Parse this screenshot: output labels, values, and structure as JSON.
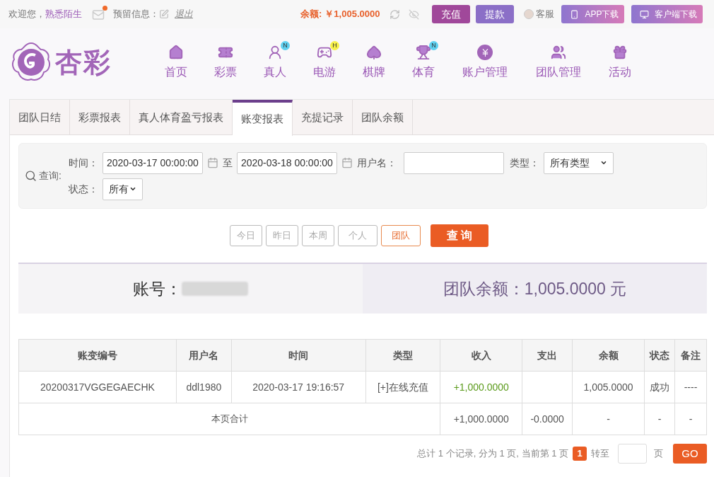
{
  "top_bar": {
    "welcome": "欢迎您，",
    "username": "熟悉陌生",
    "mail_unread": true,
    "reserved_info": "预留信息：",
    "logout": "退出",
    "balance_label": "余额:",
    "balance": "￥1,005.0000",
    "buttons": [
      {
        "label": "充值",
        "kind": "deposit"
      },
      {
        "label": "提款",
        "kind": "withdraw"
      }
    ],
    "service": "客服",
    "downloads": [
      {
        "label": "APP下载",
        "kind": "phone"
      },
      {
        "label": "客户端下载",
        "kind": "desktop"
      }
    ]
  },
  "logo": "杏彩",
  "nav": [
    {
      "label": "首页",
      "kind": "home"
    },
    {
      "label": "彩票",
      "kind": "ticket"
    },
    {
      "label": "真人",
      "kind": "person",
      "badge": "N"
    },
    {
      "label": "电游",
      "kind": "game",
      "badge": "H"
    },
    {
      "label": "棋牌",
      "kind": "cards"
    },
    {
      "label": "体育",
      "kind": "trophy",
      "badge": "N"
    },
    {
      "label": "账户管理",
      "kind": "yen"
    },
    {
      "label": "团队管理",
      "kind": "team"
    },
    {
      "label": "活动",
      "kind": "gift"
    }
  ],
  "tabs": [
    {
      "label": "团队日结",
      "selected": false
    },
    {
      "label": "彩票报表",
      "selected": false
    },
    {
      "label": "真人体育盈亏报表",
      "selected": false
    },
    {
      "label": "账变报表",
      "selected": true
    },
    {
      "label": "充提记录",
      "selected": false
    },
    {
      "label": "团队余额",
      "selected": false
    }
  ],
  "query": {
    "label": "查询:",
    "time_label": "时间：",
    "start": "2020-03-17 00:00:00",
    "to": "至",
    "end": "2020-03-18 00:00:00",
    "username_label": "用户名：",
    "type_label": "类型：",
    "type": "所有类型",
    "status_label": "状态：",
    "status": "所有"
  },
  "quick_filters": [
    {
      "label": "今日",
      "selected": false
    },
    {
      "label": "昨日",
      "selected": false
    },
    {
      "label": "本周",
      "selected": false
    },
    {
      "label": "个人",
      "selected": false
    },
    {
      "label": "团队",
      "selected": true
    }
  ],
  "search_button": "查 询",
  "summary": {
    "account_label": "账号：",
    "team_balance": "团队余额：1,005.0000 元"
  },
  "table": {
    "columns": [
      "账变编号",
      "用户名",
      "时间",
      "类型",
      "收入",
      "支出",
      "余额",
      "状态",
      "备注"
    ],
    "rows": [
      [
        "20200317VGGEGAECHK",
        "ddl1980",
        "2020-03-17 19:16:57",
        "[+]在线充值",
        "+1,000.0000",
        "",
        "1,005.0000",
        "成功",
        "----"
      ]
    ],
    "total": {
      "label": "本页合计",
      "cells": [
        "+1,000.0000",
        "-0.0000",
        "-",
        "-",
        "-"
      ]
    }
  },
  "pagination": {
    "summary": "总计 1 个记录, 分为 1 页, 当前第 1 页",
    "current": "1",
    "goto": "转至",
    "page": "页",
    "go": "GO"
  }
}
